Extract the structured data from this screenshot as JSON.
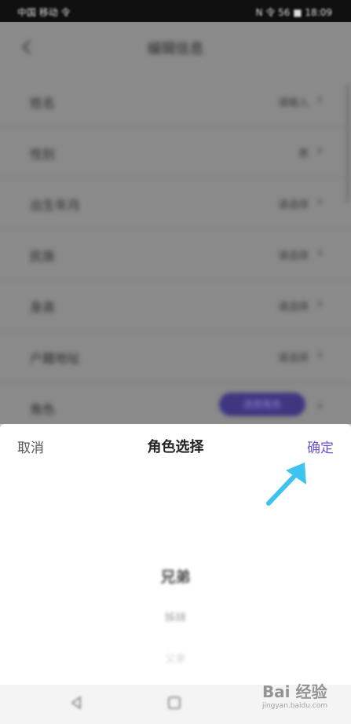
{
  "status_bar": {
    "left_text": "中国 移动 令",
    "right_text": "N 令 56 ■ 18:09"
  },
  "background": {
    "title": "编辑信息",
    "rows": [
      {
        "label": "姓名",
        "value": "请输入"
      },
      {
        "label": "性别",
        "value": "男"
      },
      {
        "label": "出生年月",
        "value": "请选择"
      },
      {
        "label": "民族",
        "value": "请选择"
      },
      {
        "label": "身高",
        "value": "请选择"
      },
      {
        "label": "户籍地址",
        "value": "请选择"
      },
      {
        "label": "角色",
        "value": "选择角色"
      }
    ]
  },
  "sheet": {
    "cancel_label": "取消",
    "title": "角色选择",
    "confirm_label": "确定",
    "picker": {
      "selected": "兄弟",
      "next": "姊妹",
      "next2": "父亲"
    }
  },
  "watermark": {
    "brand": "Bai 经验",
    "url": "jingyan.baidu.com"
  },
  "colors": {
    "accent": "#6b55d8",
    "arrow": "#3ec3f0"
  }
}
